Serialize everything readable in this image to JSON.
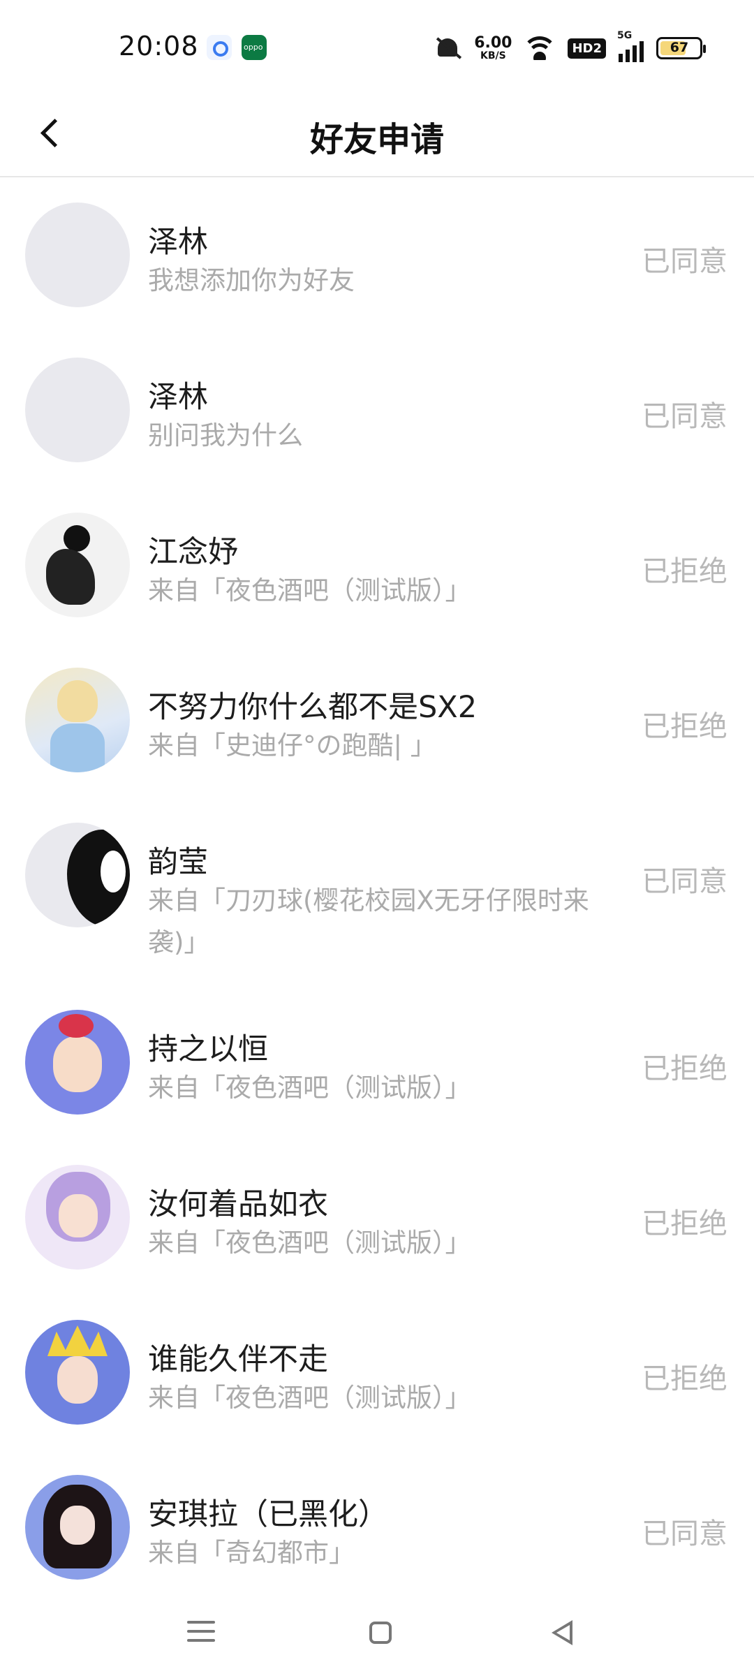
{
  "status_bar": {
    "time": "20:08",
    "net_speed_value": "6.00",
    "net_speed_unit": "KB/S",
    "hd_badge": "HD2",
    "network_label": "5G",
    "battery_level": "67",
    "battery_fraction": 0.67
  },
  "header": {
    "title": "好友申请"
  },
  "requests": [
    {
      "name": "泽林",
      "message": "我想添加你为好友",
      "status": "已同意"
    },
    {
      "name": "泽林",
      "message": "别问我为什么",
      "status": "已同意"
    },
    {
      "name": "江念妤",
      "message": "来自「夜色酒吧（测试版）」",
      "status": "已拒绝"
    },
    {
      "name": "不努力你什么都不是SX2",
      "message": "来自「史迪仔°の跑酷|  」",
      "status": "已拒绝"
    },
    {
      "name": "韵莹",
      "message": "来自「刀刃球(樱花校园X无牙仔限时来袭)」",
      "status": "已同意"
    },
    {
      "name": "持之以恒",
      "message": "来自「夜色酒吧（测试版）」",
      "status": "已拒绝"
    },
    {
      "name": "汝何着品如衣",
      "message": "来自「夜色酒吧（测试版）」",
      "status": "已拒绝"
    },
    {
      "name": "谁能久伴不走",
      "message": "来自「夜色酒吧（测试版）」",
      "status": "已拒绝"
    },
    {
      "name": "安琪拉（已黑化）",
      "message": "来自「奇幻都市」",
      "status": "已同意"
    }
  ],
  "icons": {
    "back": "chevron-left-icon",
    "nav_menu": "menu-icon",
    "nav_home": "home-square-icon",
    "nav_back": "triangle-back-icon"
  },
  "colors": {
    "status_text": "#b8b8b8",
    "message_text": "#aaaaaa",
    "name_text": "#1d1d1d",
    "battery_fill": "#f5d77a"
  }
}
